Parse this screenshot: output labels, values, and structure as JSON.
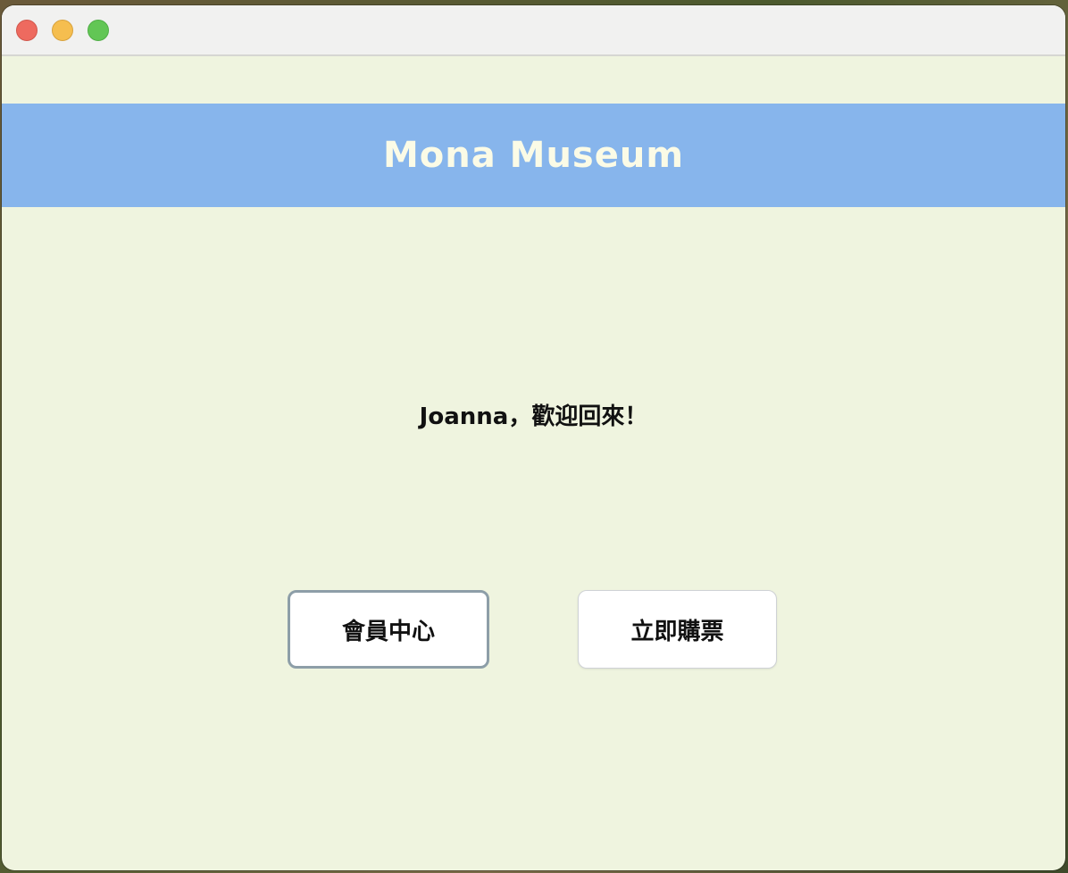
{
  "window": {
    "controls": [
      "close",
      "minimize",
      "maximize"
    ]
  },
  "header": {
    "title": "Mona Museum"
  },
  "main": {
    "welcome_text": "Joanna，歡迎回來！",
    "buttons": {
      "member_center": "會員中心",
      "buy_tickets": "立即購票"
    }
  },
  "colors": {
    "background": "#eff4df",
    "header_band": "#87b5ec",
    "header_text": "#fbfbe6"
  }
}
